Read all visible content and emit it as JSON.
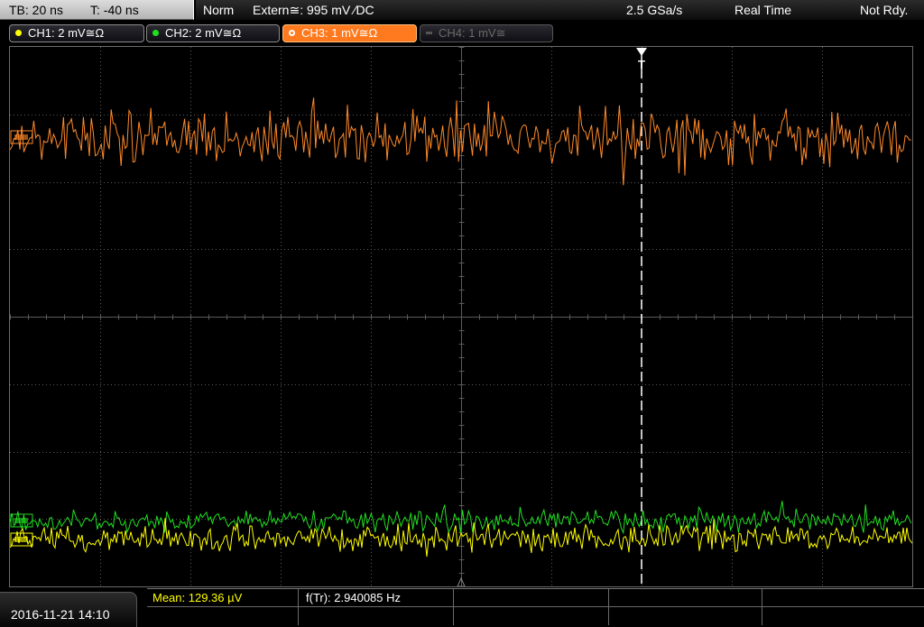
{
  "status": {
    "timebase": "TB: 20 ns",
    "trigger_time": "T: -40 ns",
    "mode": "Norm",
    "trigger_source": "Extern≅: 995 mV ∕DC",
    "sample_rate": "2.5 GSa/s",
    "acquisition": "Real Time",
    "ready": "Not Rdy."
  },
  "channels": [
    {
      "label": "CH1: 2 mV≅Ω",
      "color": "#ffff00",
      "state": "on"
    },
    {
      "label": "CH2: 2 mV≅Ω",
      "color": "#20e020",
      "state": "on"
    },
    {
      "label": "CH3: 1 mV≅Ω",
      "color": "#ff8a2a",
      "state": "selected"
    },
    {
      "label": "CH4: 1 mV≅",
      "color": "#666666",
      "state": "off"
    }
  ],
  "graph": {
    "trigger_marker": "T",
    "colors": {
      "grid": "#5a5a5a",
      "trigger_line": "#ffffff"
    }
  },
  "footer": {
    "datetime": "2016-11-21 14:10",
    "mean_label": "Mean: 129.36 µV",
    "mean_color": "#ffff00",
    "frequency_label": "f(Tr): 2.940085 Hz"
  }
}
